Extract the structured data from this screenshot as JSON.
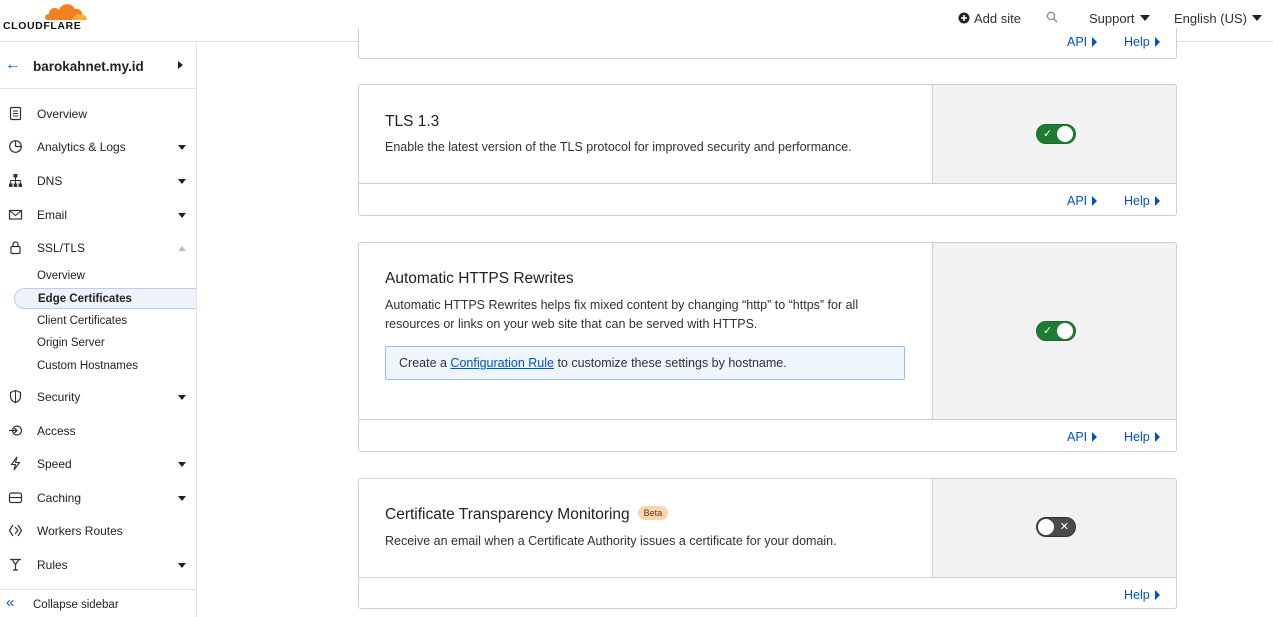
{
  "header": {
    "brand": "CLOUDFLARE",
    "add_site": "Add site",
    "support": "Support",
    "language": "English (US)"
  },
  "sidebar": {
    "zone_name": "barokahnet.my.id",
    "items": [
      {
        "label": "Overview",
        "icon": "clipboard-icon"
      },
      {
        "label": "Analytics & Logs",
        "icon": "pie-chart-icon"
      },
      {
        "label": "DNS",
        "icon": "network-icon"
      },
      {
        "label": "Email",
        "icon": "email-icon"
      },
      {
        "label": "SSL/TLS",
        "icon": "lock-icon"
      },
      {
        "label": "Security",
        "icon": "shield-icon"
      },
      {
        "label": "Access",
        "icon": "access-icon"
      },
      {
        "label": "Speed",
        "icon": "bolt-icon"
      },
      {
        "label": "Caching",
        "icon": "storage-icon"
      },
      {
        "label": "Workers Routes",
        "icon": "workers-icon"
      },
      {
        "label": "Rules",
        "icon": "rules-icon"
      }
    ],
    "ssl_sub_items": [
      "Overview",
      "Edge Certificates",
      "Client Certificates",
      "Origin Server",
      "Custom Hostnames"
    ],
    "collapse_label": "Collapse sidebar"
  },
  "cards": {
    "prev_footer": {
      "api": "API",
      "help": "Help"
    },
    "tls13": {
      "title": "TLS 1.3",
      "description": "Enable the latest version of the TLS protocol for improved security and performance.",
      "enabled": true,
      "api": "API",
      "help": "Help"
    },
    "https_rewrites": {
      "title": "Automatic HTTPS Rewrites",
      "description": "Automatic HTTPS Rewrites helps fix mixed content by changing “http” to “https” for all resources or links on your web site that can be served with HTTPS.",
      "note_prefix": "Create a ",
      "note_link": "Configuration Rule",
      "note_suffix": " to customize these settings by hostname.",
      "enabled": true,
      "api": "API",
      "help": "Help"
    },
    "ct_monitoring": {
      "title": "Certificate Transparency Monitoring",
      "badge": "Beta",
      "description": "Receive an email when a Certificate Authority issues a certificate for your domain.",
      "enabled": false,
      "help": "Help"
    }
  },
  "colors": {
    "accent": "#0051c3",
    "toggle_on": "#1e7b34",
    "brand_orange": "#f38020"
  }
}
